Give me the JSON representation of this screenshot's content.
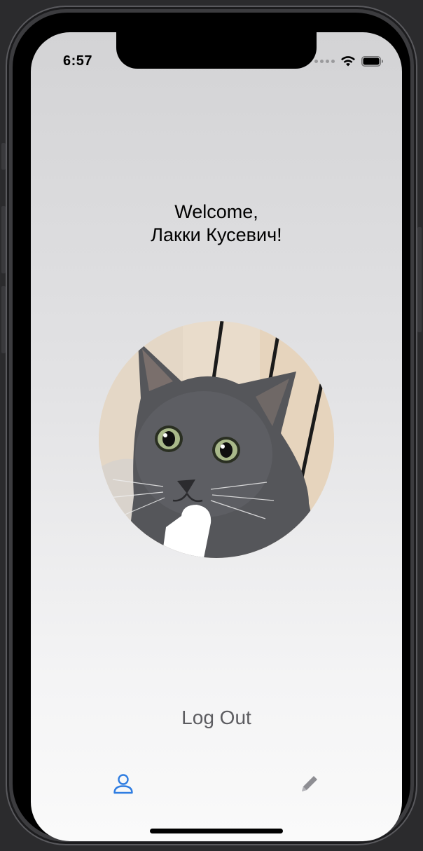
{
  "status_bar": {
    "time": "6:57",
    "icons": [
      "cellular-signal-icon",
      "wifi-icon",
      "battery-icon"
    ]
  },
  "welcome": {
    "line1": "Welcome,",
    "line2": "Лакки Кусевич!"
  },
  "profile_image": {
    "subject": "gray cat photo"
  },
  "actions": {
    "logout_label": "Log Out"
  },
  "tab_bar": {
    "tabs": [
      {
        "icon": "person-icon",
        "selected": true
      },
      {
        "icon": "pencil-icon",
        "selected": false
      }
    ]
  },
  "colors": {
    "accent": "#2f7de1",
    "inactive_tab": "#8e8e93",
    "logout_text": "#5c5c60"
  }
}
